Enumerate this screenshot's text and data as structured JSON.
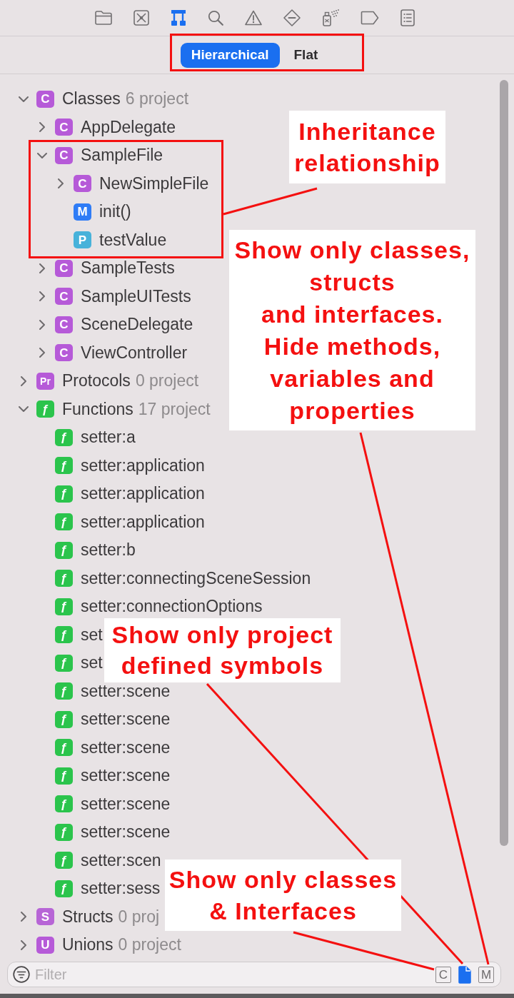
{
  "navigator_tabs": [
    {
      "selected": false
    },
    {
      "selected": false
    },
    {
      "selected": true
    },
    {
      "selected": false
    },
    {
      "selected": false
    },
    {
      "selected": false
    },
    {
      "selected": false
    },
    {
      "selected": false
    },
    {
      "selected": false
    }
  ],
  "view_mode": [
    {
      "label": "Hierarchical",
      "selected": true
    },
    {
      "label": "Flat",
      "selected": false
    }
  ],
  "symbols": [
    {
      "badge": "C",
      "color": "#b65ad8",
      "name": "Classes",
      "count": "6 project",
      "expanded": true,
      "children": [
        {
          "badge": "C",
          "color": "#b65ad8",
          "name": "AppDelegate",
          "expanded": false
        },
        {
          "badge": "C",
          "color": "#b65ad8",
          "name": "SampleFile",
          "expanded": true,
          "children": [
            {
              "badge": "C",
              "color": "#b65ad8",
              "name": "NewSimpleFile",
              "expanded": false
            },
            {
              "badge": "M",
              "color": "#2f7cf6",
              "name": "init()"
            },
            {
              "badge": "P",
              "color": "#47b2da",
              "name": "testValue"
            }
          ]
        },
        {
          "badge": "C",
          "color": "#b65ad8",
          "name": "SampleTests",
          "expanded": false
        },
        {
          "badge": "C",
          "color": "#b65ad8",
          "name": "SampleUITests",
          "expanded": false
        },
        {
          "badge": "C",
          "color": "#b65ad8",
          "name": "SceneDelegate",
          "expanded": false
        },
        {
          "badge": "C",
          "color": "#b65ad8",
          "name": "ViewController",
          "expanded": false
        }
      ]
    },
    {
      "badge": "Pr",
      "color": "#b65ad8",
      "name": "Protocols",
      "count": "0 project",
      "expanded": false
    },
    {
      "badge": "ƒ",
      "color": "#2bc44c",
      "name": "Functions",
      "count": "17 project",
      "expanded": true,
      "children": [
        {
          "badge": "ƒ",
          "color": "#2bc44c",
          "name": "setter:a"
        },
        {
          "badge": "ƒ",
          "color": "#2bc44c",
          "name": "setter:application"
        },
        {
          "badge": "ƒ",
          "color": "#2bc44c",
          "name": "setter:application"
        },
        {
          "badge": "ƒ",
          "color": "#2bc44c",
          "name": "setter:application"
        },
        {
          "badge": "ƒ",
          "color": "#2bc44c",
          "name": "setter:b"
        },
        {
          "badge": "ƒ",
          "color": "#2bc44c",
          "name": "setter:connectingSceneSession"
        },
        {
          "badge": "ƒ",
          "color": "#2bc44c",
          "name": "setter:connectionOptions"
        },
        {
          "badge": "ƒ",
          "color": "#2bc44c",
          "name": "set"
        },
        {
          "badge": "ƒ",
          "color": "#2bc44c",
          "name": "set"
        },
        {
          "badge": "ƒ",
          "color": "#2bc44c",
          "name": "setter:scene"
        },
        {
          "badge": "ƒ",
          "color": "#2bc44c",
          "name": "setter:scene"
        },
        {
          "badge": "ƒ",
          "color": "#2bc44c",
          "name": "setter:scene"
        },
        {
          "badge": "ƒ",
          "color": "#2bc44c",
          "name": "setter:scene"
        },
        {
          "badge": "ƒ",
          "color": "#2bc44c",
          "name": "setter:scene"
        },
        {
          "badge": "ƒ",
          "color": "#2bc44c",
          "name": "setter:scene"
        },
        {
          "badge": "ƒ",
          "color": "#2bc44c",
          "name": "setter:scen"
        },
        {
          "badge": "ƒ",
          "color": "#2bc44c",
          "name": "setter:sess"
        }
      ]
    },
    {
      "badge": "S",
      "color": "#b765d6",
      "name": "Structs",
      "count": "0 proj",
      "expanded": false
    },
    {
      "badge": "U",
      "color": "#b65ad8",
      "name": "Unions",
      "count": "0 project",
      "expanded": false
    }
  ],
  "filter": {
    "placeholder": "Filter",
    "toggles": [
      {
        "kind": "letter",
        "label": "C",
        "on": false
      },
      {
        "kind": "icon",
        "on": true
      },
      {
        "kind": "letter",
        "label": "M",
        "on": false
      }
    ]
  },
  "annotations": [
    {
      "text": "Inheritance\nrelationship"
    },
    {
      "text": "Show only classes,\nstructs\nand interfaces.\nHide methods,\nvariables and\nproperties"
    },
    {
      "text": "Show only project\ndefined symbols"
    },
    {
      "text": "Show only classes\n& Interfaces"
    }
  ]
}
